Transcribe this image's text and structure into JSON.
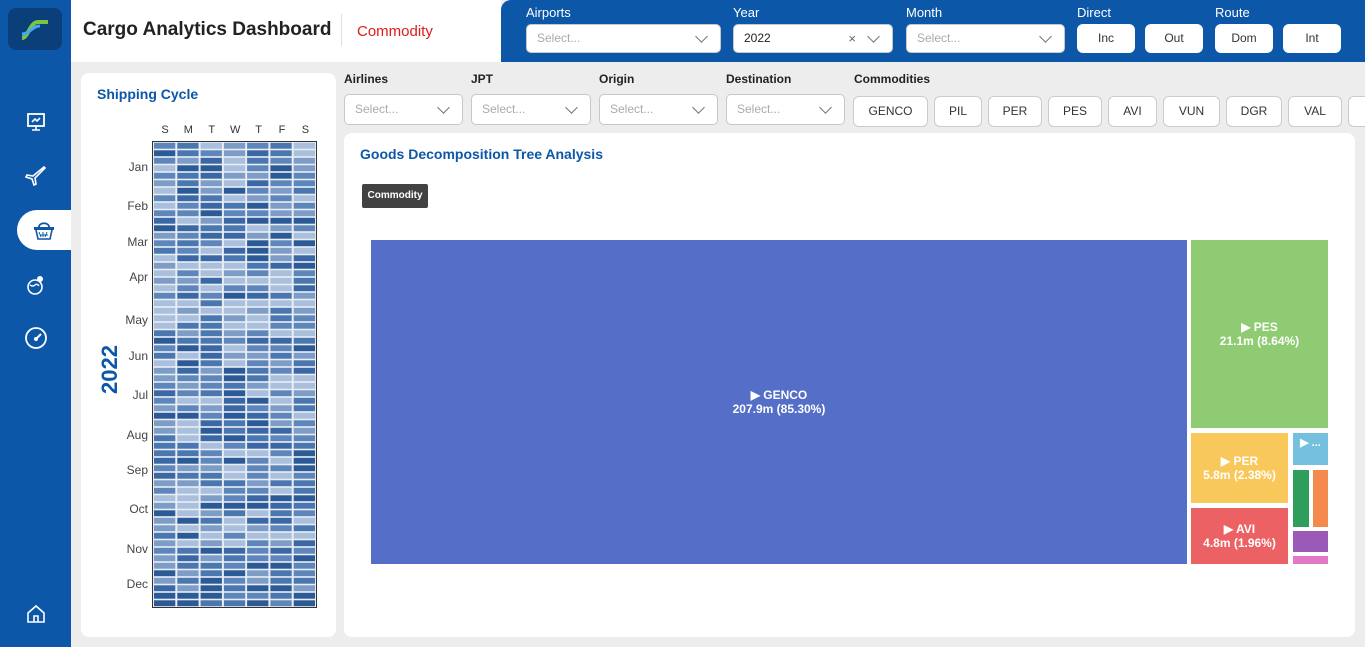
{
  "header": {
    "title": "Cargo Analytics Dashboard",
    "page": "Commodity"
  },
  "nav": {
    "icons": [
      "presentation-icon",
      "plane-icon",
      "basket-icon",
      "globe-pin-icon",
      "gauge-icon",
      "home-icon"
    ]
  },
  "top_filters": {
    "airports": {
      "label": "Airports",
      "placeholder": "Select..."
    },
    "year": {
      "label": "Year",
      "value": "2022",
      "clear": "×"
    },
    "month": {
      "label": "Month",
      "placeholder": "Select..."
    },
    "direct": {
      "label": "Direct",
      "options": [
        "Inc",
        "Out"
      ]
    },
    "route": {
      "label": "Route",
      "options": [
        "Dom",
        "Int"
      ]
    }
  },
  "sub_filters": {
    "airlines": {
      "label": "Airlines",
      "placeholder": "Select..."
    },
    "jpt": {
      "label": "JPT",
      "placeholder": "Select..."
    },
    "origin": {
      "label": "Origin",
      "placeholder": "Select..."
    },
    "destination": {
      "label": "Destination",
      "placeholder": "Select..."
    },
    "commodities": {
      "label": "Commodities",
      "chips": [
        "GENCO",
        "PIL",
        "PER",
        "PES",
        "AVI",
        "VUN",
        "DGR",
        "VAL"
      ]
    }
  },
  "shipping_cycle": {
    "title": "Shipping Cycle",
    "year": "2022",
    "days": [
      "S",
      "M",
      "T",
      "W",
      "T",
      "F",
      "S"
    ],
    "months": [
      "Jan",
      "Feb",
      "Mar",
      "Apr",
      "May",
      "Jun",
      "Jul",
      "Aug",
      "Sep",
      "Oct",
      "Nov",
      "Dec"
    ]
  },
  "tree": {
    "title": "Goods Decomposition Tree Analysis",
    "tag": "Commodity",
    "colors": {
      "GENCO": "#556ec8",
      "PES": "#8fcb72",
      "PER": "#f8c95a",
      "AVI": "#ec6264",
      "other": "#75c0de"
    },
    "items": [
      {
        "name": "▶ GENCO",
        "value": "207.9m (85.30%)"
      },
      {
        "name": "▶ PES",
        "value": "21.1m (8.64%)"
      },
      {
        "name": "▶ PER",
        "value": "5.8m (2.38%)"
      },
      {
        "name": "▶ AVI",
        "value": "4.8m (1.96%)"
      },
      {
        "name": "▶ ...",
        "value": ""
      }
    ]
  }
}
